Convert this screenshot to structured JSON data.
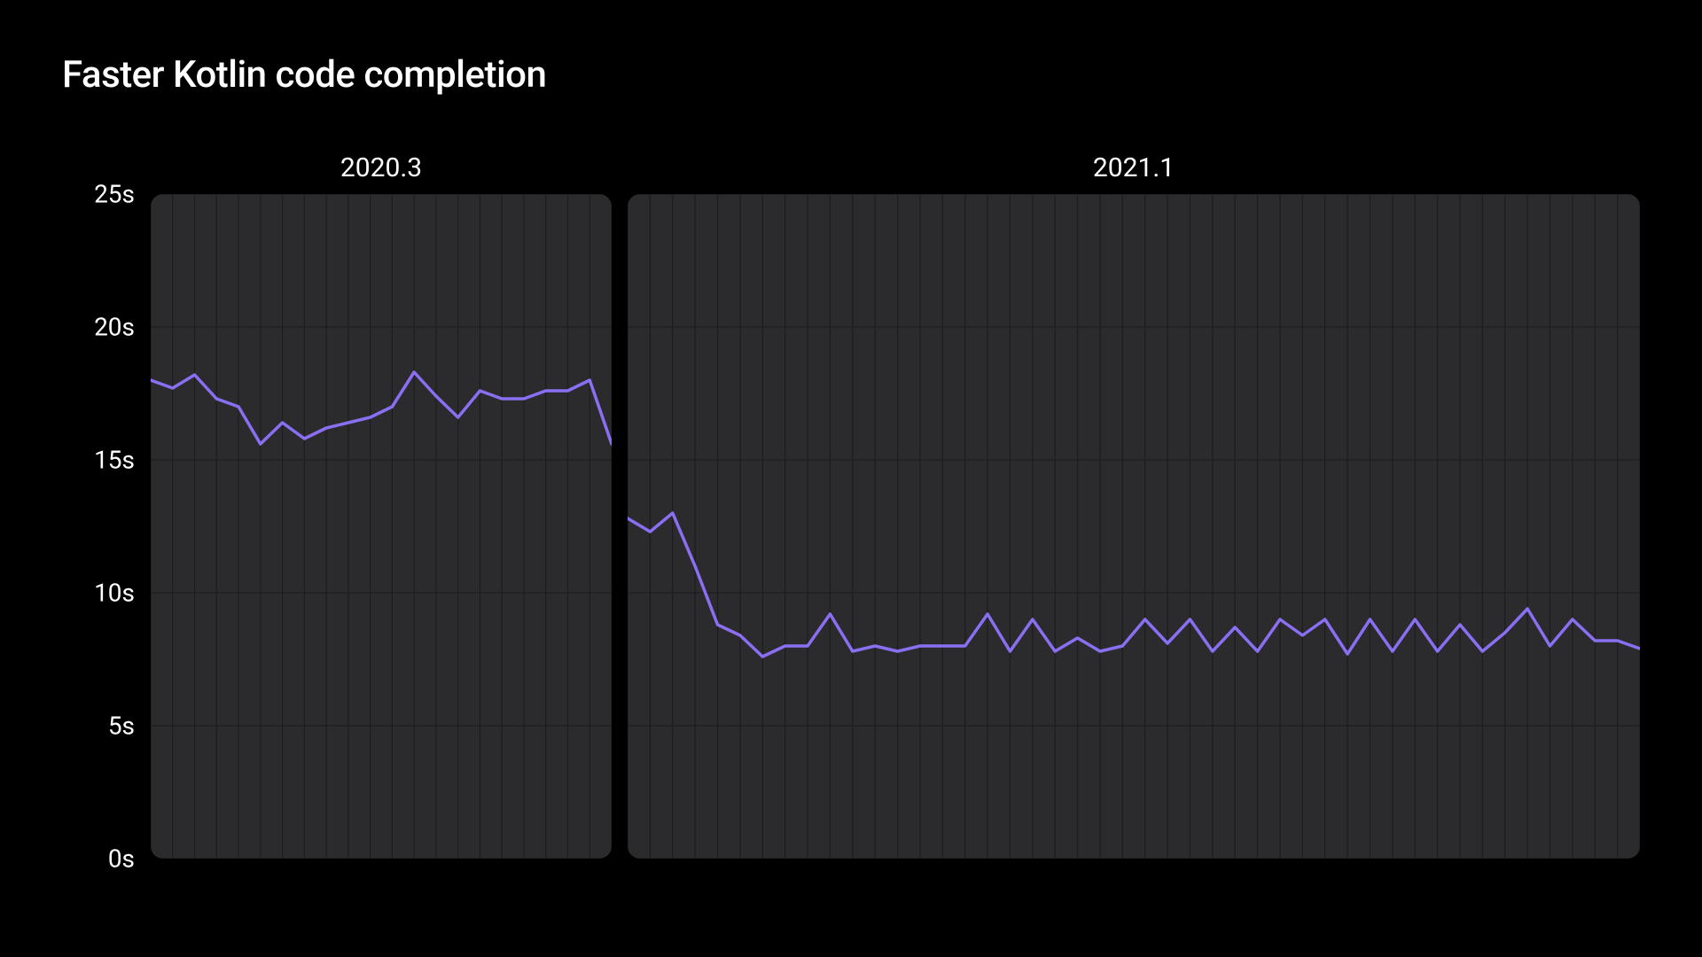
{
  "title": "Faster Kotlin code completion",
  "y_ticks": [
    "25s",
    "20s",
    "15s",
    "10s",
    "5s",
    "0s"
  ],
  "panels": {
    "left": {
      "label": "2020.3"
    },
    "right": {
      "label": "2021.1"
    }
  },
  "colors": {
    "line": "#8b6ff2",
    "panel_bg": "#2b2b2e",
    "grid": "#1d1d1f"
  },
  "chart_data": [
    {
      "type": "line",
      "title": "Faster Kotlin code completion",
      "ylabel": "seconds",
      "ylim": [
        0,
        25
      ],
      "xlabel": "",
      "series_name": "2020.3",
      "x": [
        0,
        1,
        2,
        3,
        4,
        5,
        6,
        7,
        8,
        9,
        10,
        11,
        12,
        13,
        14,
        15,
        16,
        17,
        18,
        19,
        20,
        21
      ],
      "values": [
        18.0,
        17.7,
        18.2,
        17.3,
        17.0,
        15.6,
        16.4,
        15.8,
        16.2,
        16.4,
        16.6,
        17.0,
        18.3,
        17.4,
        16.6,
        17.6,
        17.3,
        17.3,
        17.6,
        17.6,
        18.0,
        15.6
      ]
    },
    {
      "type": "line",
      "title": "Faster Kotlin code completion",
      "ylabel": "seconds",
      "ylim": [
        0,
        25
      ],
      "xlabel": "",
      "series_name": "2021.1",
      "x": [
        0,
        1,
        2,
        3,
        4,
        5,
        6,
        7,
        8,
        9,
        10,
        11,
        12,
        13,
        14,
        15,
        16,
        17,
        18,
        19,
        20,
        21,
        22,
        23,
        24,
        25,
        26,
        27,
        28,
        29,
        30,
        31,
        32,
        33,
        34,
        35,
        36,
        37,
        38,
        39,
        40,
        41,
        42,
        43,
        44,
        45
      ],
      "values": [
        12.8,
        12.3,
        13.0,
        11.0,
        8.8,
        8.4,
        7.6,
        8.0,
        8.0,
        9.2,
        7.8,
        8.0,
        7.8,
        8.0,
        8.0,
        8.0,
        9.2,
        7.8,
        9.0,
        7.8,
        8.3,
        7.8,
        8.0,
        9.0,
        8.1,
        9.0,
        7.8,
        8.7,
        7.8,
        9.0,
        8.4,
        9.0,
        7.7,
        9.0,
        7.8,
        9.0,
        7.8,
        8.8,
        7.8,
        8.5,
        9.4,
        8.0,
        9.0,
        8.2,
        8.2,
        7.9
      ]
    }
  ]
}
